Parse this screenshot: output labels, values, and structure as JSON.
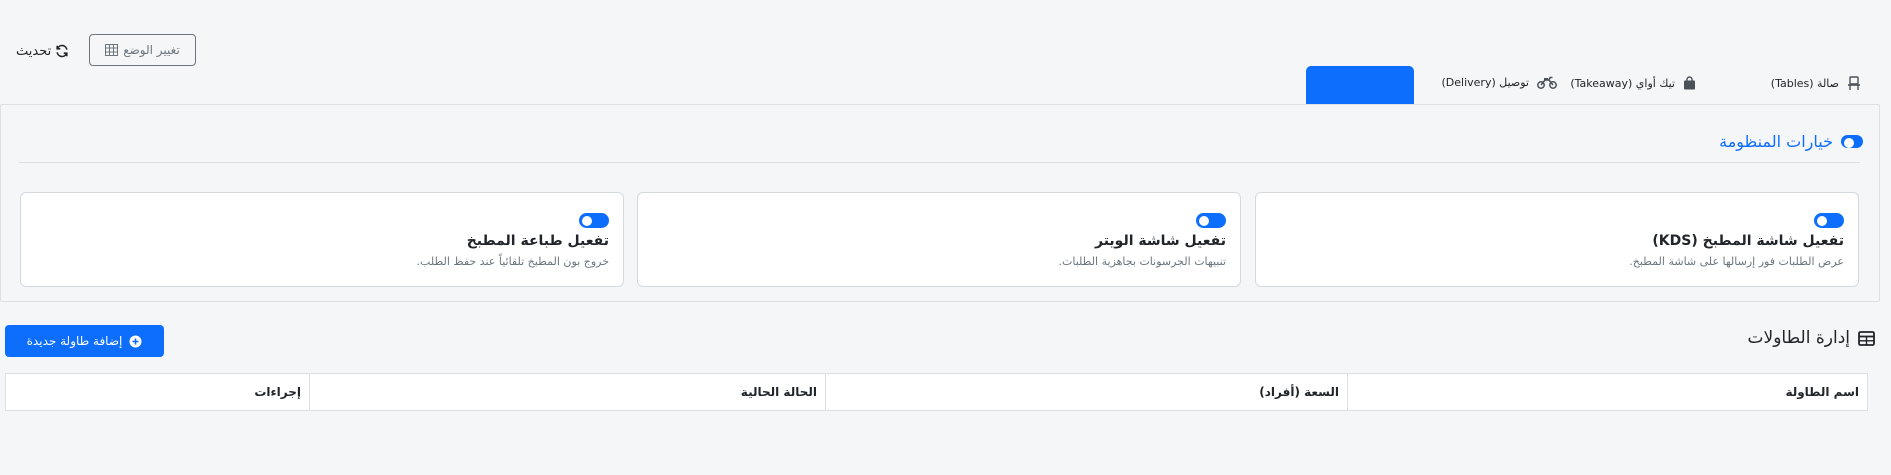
{
  "top_actions": {
    "refresh_label": "تحديث",
    "refresh_icon": "refresh-icon",
    "mode_label": "تغيير الوضع",
    "mode_icon": "grid-icon"
  },
  "service_tabs": {
    "items": [
      {
        "label": "صالة (Tables)",
        "icon": "chair-icon"
      },
      {
        "label": "تيك أواي (Takeaway)",
        "icon": "shopping-bag-icon"
      },
      {
        "label": "توصيل (Delivery)",
        "icon": "motorcycle-icon"
      }
    ],
    "active_color": "#0d6efd"
  },
  "settings": {
    "title": "خيارات المنظومة",
    "cards": [
      {
        "title": "تفعيل شاشة المطبخ (KDS)",
        "description": "عرض الطلبات فور إرسالها على شاشة المطبخ.",
        "enabled": true
      },
      {
        "title": "تفعيل شاشة الويتر",
        "description": "تنبيهات الجرسونات بجاهزية الطلبات.",
        "enabled": true
      },
      {
        "title": "تفعيل طباعة المطبخ",
        "description": "خروج بون المطبخ تلقائياً عند حفظ الطلب.",
        "enabled": true
      }
    ]
  },
  "tables_section": {
    "title": "إدارة الطاولات",
    "add_button_label": "إضافة طاولة جديدة",
    "columns": [
      "اسم الطاولة",
      "السعة (أفراد)",
      "الحالة الحالية",
      "إجراءات"
    ],
    "rows": []
  },
  "colors": {
    "primary": "#0d6efd",
    "background": "#f5f6f8",
    "border": "#dde1e6"
  }
}
